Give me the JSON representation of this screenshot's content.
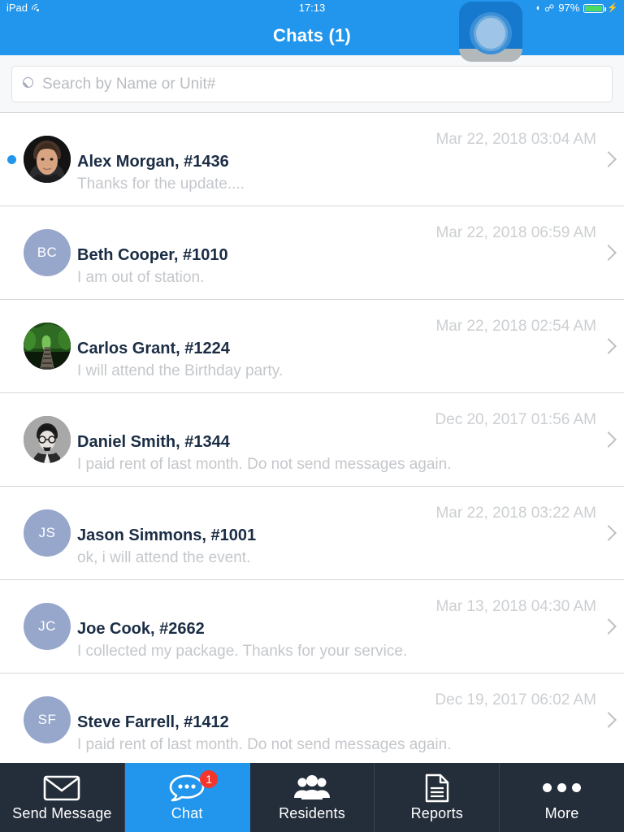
{
  "status_bar": {
    "device": "iPad",
    "wifi_icon": "wifi-icon",
    "time": "17:13",
    "rotation_lock_icon": "rotation-lock-icon",
    "bluetooth_icon": "bluetooth-icon",
    "battery_percent": "97%",
    "battery_level": 97,
    "charging": true
  },
  "header": {
    "title": "Chats (1)",
    "background": "#2196EC"
  },
  "assistive_touch": {
    "name": "assistive-touch-button"
  },
  "search": {
    "placeholder": "Search by Name or Unit#",
    "value": "",
    "icon": "search-icon"
  },
  "chats": [
    {
      "name": "Alex Morgan, #1436",
      "preview": "Thanks for the update....",
      "date": "Mar 22, 2018 03:04 AM",
      "unread": true,
      "avatar_type": "photo-man",
      "initials": ""
    },
    {
      "name": "Beth Cooper, #1010",
      "preview": "I am out of station.",
      "date": "Mar 22, 2018 06:59 AM",
      "unread": false,
      "avatar_type": "initials",
      "initials": "BC"
    },
    {
      "name": "Carlos Grant, #1224",
      "preview": "I will attend the Birthday party.",
      "date": "Mar 22, 2018 02:54 AM",
      "unread": false,
      "avatar_type": "photo-forest",
      "initials": ""
    },
    {
      "name": "Daniel Smith, #1344",
      "preview": "I paid rent of last month. Do not send messages again.",
      "date": "Dec 20, 2017 01:56 AM",
      "unread": false,
      "avatar_type": "photo-illustration",
      "initials": ""
    },
    {
      "name": "Jason Simmons, #1001",
      "preview": "ok, i will attend  the event.",
      "date": "Mar 22, 2018 03:22 AM",
      "unread": false,
      "avatar_type": "initials",
      "initials": "JS"
    },
    {
      "name": "Joe Cook, #2662",
      "preview": "I collected my package. Thanks for your service.",
      "date": "Mar 13, 2018 04:30 AM",
      "unread": false,
      "avatar_type": "initials",
      "initials": "JC"
    },
    {
      "name": "Steve Farrell, #1412",
      "preview": "I paid rent of last month. Do not send messages again.",
      "date": "Dec 19, 2017 06:02 AM",
      "unread": false,
      "avatar_type": "initials",
      "initials": "SF"
    }
  ],
  "tabbar": {
    "active_index": 1,
    "active_color": "#2196EC",
    "background": "#242E3A",
    "badge_color": "#F4352C",
    "tabs": [
      {
        "label": "Send Message",
        "icon": "envelope-icon",
        "badge": ""
      },
      {
        "label": "Chat",
        "icon": "chat-bubble-icon",
        "badge": "1"
      },
      {
        "label": "Residents",
        "icon": "people-group-icon",
        "badge": ""
      },
      {
        "label": "Reports",
        "icon": "document-icon",
        "badge": ""
      },
      {
        "label": "More",
        "icon": "ellipsis-icon",
        "badge": ""
      }
    ]
  }
}
